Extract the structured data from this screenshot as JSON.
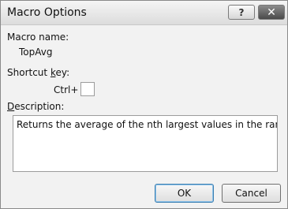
{
  "window": {
    "title": "Macro Options",
    "help_glyph": "?",
    "close_glyph": "✕"
  },
  "macro": {
    "name_label": "Macro name:",
    "name_value": "TopAvg"
  },
  "shortcut": {
    "label_pre": "Shortcut ",
    "label_accel": "k",
    "label_post": "ey:",
    "prefix": "Ctrl+",
    "value": ""
  },
  "description": {
    "label_accel": "D",
    "label_post": "escription:",
    "value": "Returns the average of the nth largest values in the range"
  },
  "buttons": {
    "ok": "OK",
    "cancel": "Cancel"
  }
}
